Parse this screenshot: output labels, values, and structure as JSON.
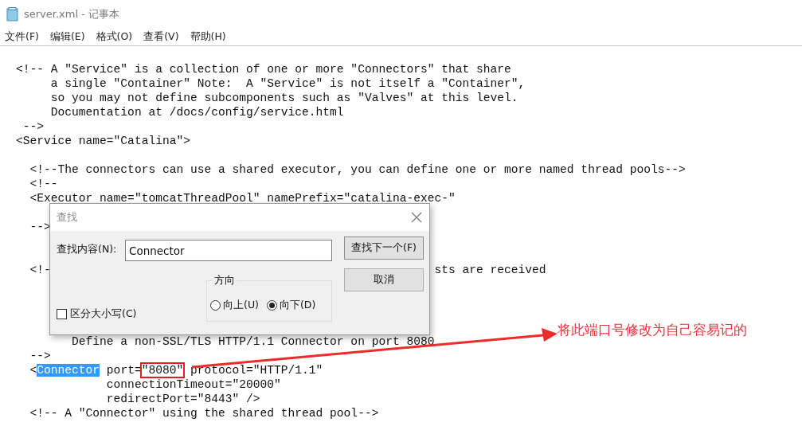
{
  "window": {
    "title": "server.xml - 记事本"
  },
  "menu": [
    "文件(F)",
    "编辑(E)",
    "格式(O)",
    "查看(V)",
    "帮助(H)"
  ],
  "editor": {
    "lines": [
      {
        "kind": "code",
        "text": "<!-- A \"Service\" is a collection of one or more \"Connectors\" that share"
      },
      {
        "kind": "code",
        "text": "     a single \"Container\" Note:  A \"Service\" is not itself a \"Container\","
      },
      {
        "kind": "code",
        "text": "     so you may not define subcomponents such as \"Valves\" at this level."
      },
      {
        "kind": "code",
        "text": "     Documentation at /docs/config/service.html"
      },
      {
        "kind": "code",
        "text": " -->"
      },
      {
        "kind": "code",
        "text": "<Service name=\"Catalina\">"
      },
      {
        "kind": "blank"
      },
      {
        "kind": "code",
        "text": "  <!--The connectors can use a shared executor, you can define one or more named thread pools-->"
      },
      {
        "kind": "code",
        "text": "  <!--"
      },
      {
        "kind": "code",
        "text": "  <Executor name=\"tomcatThreadPool\" namePrefix=\"catalina-exec-\""
      },
      {
        "kind": "blank"
      },
      {
        "kind": "code",
        "text": "  -->"
      },
      {
        "kind": "blank"
      },
      {
        "kind": "blank"
      },
      {
        "kind": "mixed",
        "segments": [
          {
            "kind": "plain",
            "text": "  <!-"
          },
          {
            "kind": "after_dialog",
            "text": "sts are received"
          }
        ]
      },
      {
        "kind": "blank"
      },
      {
        "kind": "blank"
      },
      {
        "kind": "blank"
      },
      {
        "kind": "blank"
      },
      {
        "kind": "code",
        "text": "        Define a non-SSL/TLS HTTP/1.1 Connector on port 8080"
      },
      {
        "kind": "code",
        "text": "  -->"
      },
      {
        "kind": "mixed",
        "segments": [
          {
            "kind": "plain",
            "text": "  <"
          },
          {
            "kind": "selection",
            "text": "Connector"
          },
          {
            "kind": "plain",
            "text": " port="
          },
          {
            "kind": "boxed",
            "text": "\"8080\""
          },
          {
            "kind": "plain",
            "text": " protocol=\"HTTP/1.1\""
          }
        ]
      },
      {
        "kind": "code",
        "text": "             connectionTimeout=\"20000\""
      },
      {
        "kind": "code",
        "text": "             redirectPort=\"8443\" />"
      },
      {
        "kind": "code",
        "text": "  <!-- A \"Connector\" using the shared thread pool-->"
      }
    ]
  },
  "find_dialog": {
    "title": "查找",
    "find_label": "查找内容(N):",
    "find_value": "Connector",
    "match_case": {
      "label": "区分大小写(C)",
      "checked": false
    },
    "direction": {
      "label": "方向",
      "options": [
        {
          "label": "向上(U)",
          "selected": false
        },
        {
          "label": "向下(D)",
          "selected": true
        }
      ]
    },
    "buttons": [
      "查找下一个(F)",
      "取消"
    ]
  },
  "annotation": {
    "text": "将此端口号修改为自己容易记的"
  }
}
